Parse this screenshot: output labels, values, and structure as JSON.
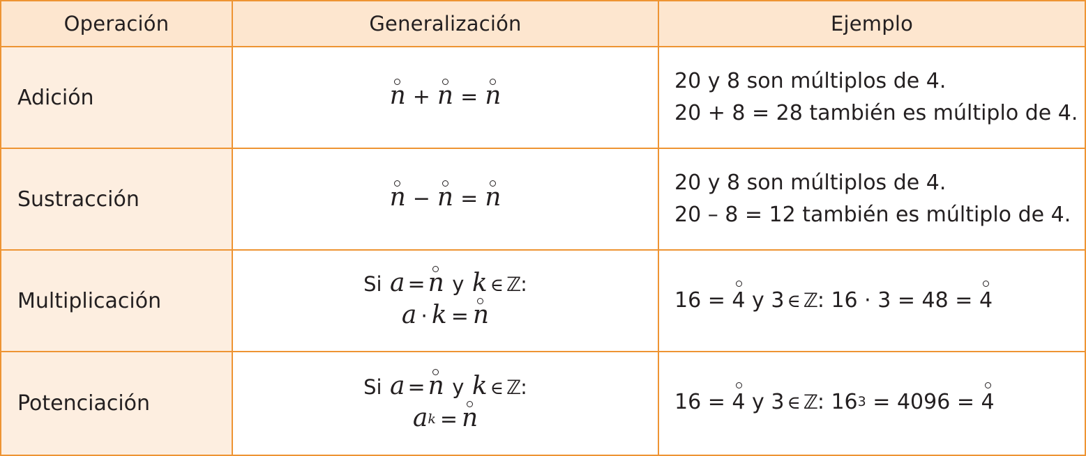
{
  "headers": {
    "operation": "Operación",
    "generalization": "Generalización",
    "example": "Ejemplo"
  },
  "rows": [
    {
      "operation": "Adición",
      "generalization": {
        "lhs1": "n",
        "op": "+",
        "lhs2": "n",
        "eq": "=",
        "rhs": "n"
      },
      "example": {
        "line1": "20 y 8 son múltiplos de 4.",
        "line2": "20 + 8 = 28 también es múltiplo de 4."
      }
    },
    {
      "operation": "Sustracción",
      "generalization": {
        "lhs1": "n",
        "op": "−",
        "lhs2": "n",
        "eq": "=",
        "rhs": "n"
      },
      "example": {
        "line1": "20 y 8 son múltiplos de 4.",
        "line2": "20 – 8 = 12 también es múltiplo de 4."
      }
    },
    {
      "operation": "Multiplicación",
      "generalization": {
        "line1": {
          "si": "Si",
          "a": "a",
          "eq": "=",
          "n": "n",
          "y": "y",
          "k": "k",
          "in": "∈",
          "set": "ℤ",
          "colon": ":"
        },
        "line2": {
          "a": "a",
          "dot": "·",
          "k": "k",
          "eq": "=",
          "n": "n"
        }
      },
      "example": {
        "p1": "16 =",
        "ring1": "4",
        "p2": "y 3",
        "in": "∈",
        "set": "ℤ",
        "p3": ": 16 · 3 = 48 =",
        "ring2": "4"
      }
    },
    {
      "operation": "Potenciación",
      "generalization": {
        "line1": {
          "si": "Si",
          "a": "a",
          "eq": "=",
          "n": "n",
          "y": "y",
          "k": "k",
          "in": "∈",
          "set": "ℤ",
          "colon": ":"
        },
        "line2": {
          "a": "a",
          "exp": "k",
          "eq": "=",
          "n": "n"
        }
      },
      "example": {
        "p1": "16 =",
        "ring1": "4",
        "p2": "y 3",
        "in": "∈",
        "set": "ℤ",
        "p3a": ": 16",
        "exp": "3",
        "p3b": "= 4096 =",
        "ring2": "4"
      }
    }
  ]
}
